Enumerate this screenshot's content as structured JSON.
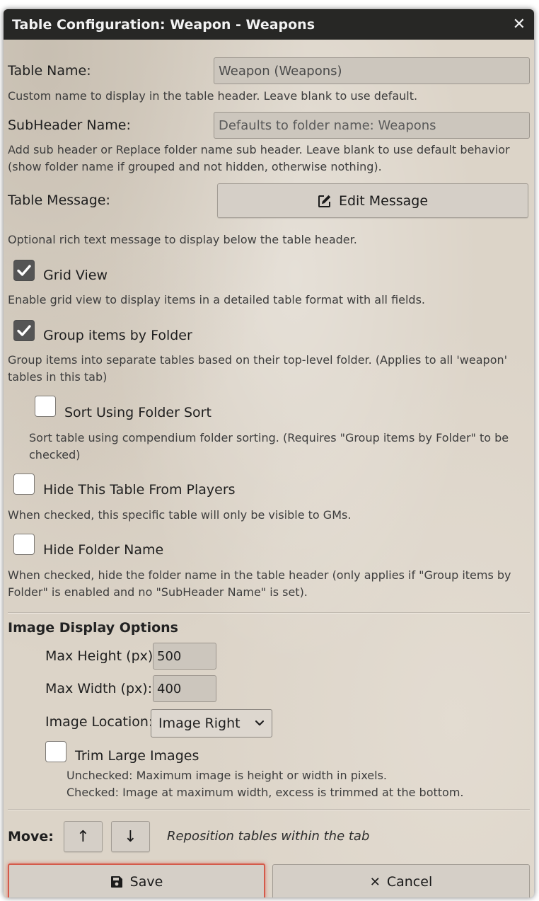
{
  "dialog": {
    "title": "Table Configuration: Weapon - Weapons",
    "close_glyph": "✕"
  },
  "table_name": {
    "label": "Table Name:",
    "value": "Weapon (Weapons)",
    "hint": "Custom name to display in the table header. Leave blank to use default."
  },
  "subheader": {
    "label": "SubHeader Name:",
    "placeholder": "Defaults to folder name: Weapons",
    "hint": "Add sub header or Replace folder name sub header. Leave blank to use default behavior (show folder name if grouped and not hidden, otherwise nothing)."
  },
  "table_message": {
    "label": "Table Message:",
    "button_label": "Edit Message",
    "icon": "edit-icon",
    "hint": "Optional rich text message to display below the table header."
  },
  "options": [
    {
      "label": "Grid View",
      "checked": true,
      "hint": "Enable grid view to display items in a detailed table format with all fields."
    },
    {
      "label": "Group items by Folder",
      "checked": true,
      "hint": "Group items into separate tables based on their top-level folder. (Applies to all 'weapon' tables in this tab)"
    },
    {
      "label": "Sort Using Folder Sort",
      "checked": false,
      "hint": "Sort table using compendium folder sorting. (Requires \"Group items by Folder\" to be checked)"
    },
    {
      "label": "Hide This Table From Players",
      "checked": false,
      "hint": "When checked, this specific table will only be visible to GMs."
    },
    {
      "label": "Hide Folder Name",
      "checked": false,
      "hint": "When checked, hide the folder name in the table header (only applies if \"Group items by Folder\" is enabled and no \"SubHeader Name\" is set)."
    }
  ],
  "image": {
    "section_title": "Image Display Options",
    "max_height_label": "Max Height (px):",
    "max_height_value": "500",
    "max_width_label": "Max Width (px):",
    "max_width_value": "400",
    "location_label": "Image Location:",
    "location_value": "Image Right",
    "trim_label": "Trim Large Images",
    "trim_checked": false,
    "trim_hint_1": "Unchecked: Maximum image is height or width in pixels.",
    "trim_hint_2": "Checked: Image at maximum width, excess is trimmed at the bottom."
  },
  "move": {
    "label": "Move:",
    "up_glyph": "↑",
    "down_glyph": "↓",
    "hint": "Reposition tables within the tab"
  },
  "footer": {
    "save_label": "Save",
    "cancel_label": "Cancel",
    "cancel_glyph": "✕"
  }
}
